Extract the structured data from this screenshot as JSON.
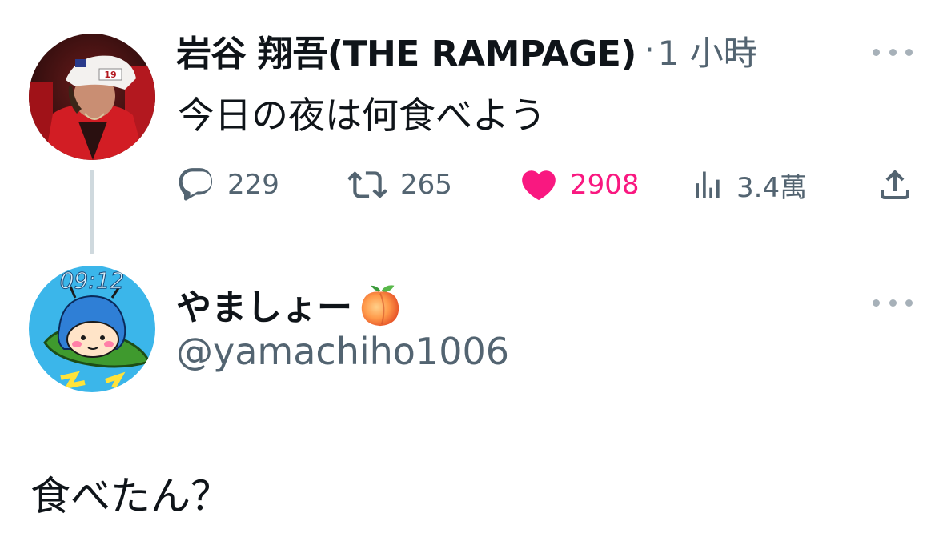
{
  "original_tweet": {
    "author_display_name": "岩谷 翔吾(THE RAMPAGE)",
    "separator": "·",
    "timestamp": "1 小時",
    "text": "今日の夜は何食べよう",
    "avatar_icon": "profile-photo-man-red-jacket-cap",
    "actions": {
      "reply_count": "229",
      "retweet_count": "265",
      "like_count": "2908",
      "view_count": "3.4萬"
    }
  },
  "reply": {
    "author_display_name": "やましょー",
    "name_emoji_icon": "peach-icon",
    "handle": "@yamachiho1006",
    "avatar_icon": "cartoon-girl-blue-hair",
    "avatar_clock_text": "09:12",
    "text": "食べたん？"
  },
  "colors": {
    "like_pink": "#f91880",
    "secondary_gray": "#536471",
    "primary_text": "#0f1419",
    "thread_line": "#cfd9de"
  }
}
